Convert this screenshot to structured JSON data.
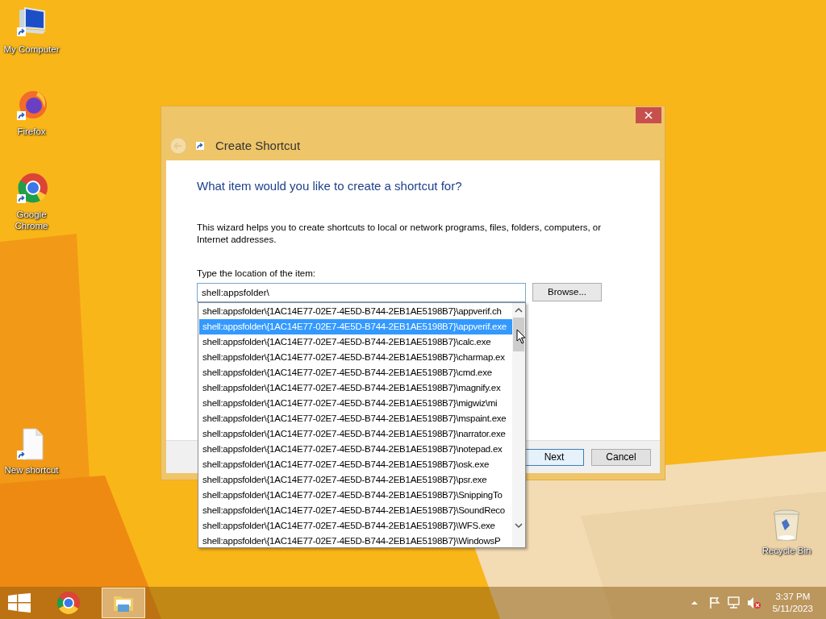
{
  "desktop_icons": [
    {
      "label": "My Computer",
      "kind": "computer"
    },
    {
      "label": "Firefox",
      "kind": "firefox"
    },
    {
      "label": "Google Chrome",
      "kind": "chrome"
    },
    {
      "label": "New shortcut",
      "kind": "file"
    },
    {
      "label": "Recycle Bin",
      "kind": "bin"
    }
  ],
  "window": {
    "title": "Create Shortcut",
    "heading": "What item would you like to create a shortcut for?",
    "description": "This wizard helps you to create shortcuts to local or network programs, files, folders, computers, or Internet addresses.",
    "field_label": "Type the location of the item:",
    "field_value": "shell:appsfolder\\",
    "browse_button": "Browse...",
    "dropdown": [
      {
        "text": "shell:appsfolder\\{1AC14E77-02E7-4E5D-B744-2EB1AE5198B7}\\appverif.ch",
        "selected": false
      },
      {
        "text": "shell:appsfolder\\{1AC14E77-02E7-4E5D-B744-2EB1AE5198B7}\\appverif.exe",
        "selected": true
      },
      {
        "text": "shell:appsfolder\\{1AC14E77-02E7-4E5D-B744-2EB1AE5198B7}\\calc.exe",
        "selected": false
      },
      {
        "text": "shell:appsfolder\\{1AC14E77-02E7-4E5D-B744-2EB1AE5198B7}\\charmap.ex",
        "selected": false
      },
      {
        "text": "shell:appsfolder\\{1AC14E77-02E7-4E5D-B744-2EB1AE5198B7}\\cmd.exe",
        "selected": false
      },
      {
        "text": "shell:appsfolder\\{1AC14E77-02E7-4E5D-B744-2EB1AE5198B7}\\magnify.ex",
        "selected": false
      },
      {
        "text": "shell:appsfolder\\{1AC14E77-02E7-4E5D-B744-2EB1AE5198B7}\\migwiz\\mi",
        "selected": false
      },
      {
        "text": "shell:appsfolder\\{1AC14E77-02E7-4E5D-B744-2EB1AE5198B7}\\mspaint.exe",
        "selected": false
      },
      {
        "text": "shell:appsfolder\\{1AC14E77-02E7-4E5D-B744-2EB1AE5198B7}\\narrator.exe",
        "selected": false
      },
      {
        "text": "shell:appsfolder\\{1AC14E77-02E7-4E5D-B744-2EB1AE5198B7}\\notepad.ex",
        "selected": false
      },
      {
        "text": "shell:appsfolder\\{1AC14E77-02E7-4E5D-B744-2EB1AE5198B7}\\osk.exe",
        "selected": false
      },
      {
        "text": "shell:appsfolder\\{1AC14E77-02E7-4E5D-B744-2EB1AE5198B7}\\psr.exe",
        "selected": false
      },
      {
        "text": "shell:appsfolder\\{1AC14E77-02E7-4E5D-B744-2EB1AE5198B7}\\SnippingTo",
        "selected": false
      },
      {
        "text": "shell:appsfolder\\{1AC14E77-02E7-4E5D-B744-2EB1AE5198B7}\\SoundReco",
        "selected": false
      },
      {
        "text": "shell:appsfolder\\{1AC14E77-02E7-4E5D-B744-2EB1AE5198B7}\\WFS.exe",
        "selected": false
      },
      {
        "text": "shell:appsfolder\\{1AC14E77-02E7-4E5D-B744-2EB1AE5198B7}\\WindowsP",
        "selected": false
      }
    ],
    "buttons": [
      {
        "label": "Next",
        "kind": "default"
      },
      {
        "label": "Cancel",
        "kind": "normal"
      }
    ]
  },
  "taskbar": {
    "apps": [
      {
        "kind": "chrome",
        "selected": false
      },
      {
        "kind": "explorer",
        "selected": true
      }
    ],
    "clock": {
      "time": "3:37 PM",
      "date": "5/11/2023"
    }
  }
}
